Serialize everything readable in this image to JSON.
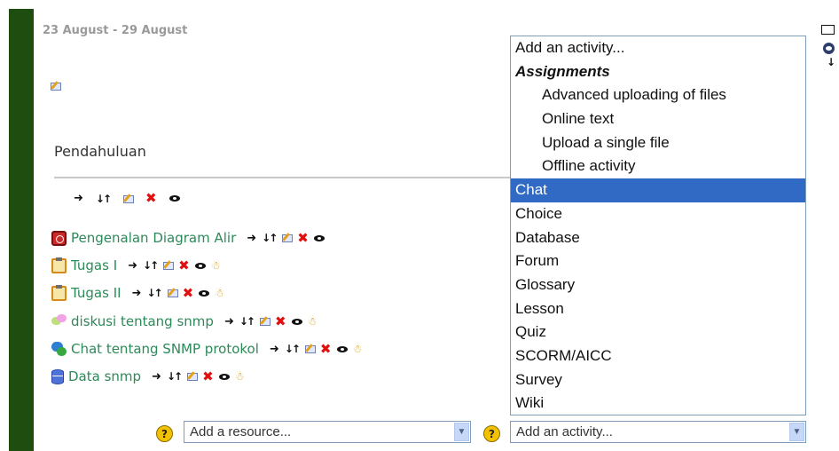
{
  "section": {
    "date_range": "23 August - 29 August",
    "title": "Pendahuluan"
  },
  "activities": [
    {
      "name": "Pengenalan Diagram Alir",
      "icon": "lesson-icon",
      "has_roles": false
    },
    {
      "name": "Tugas I",
      "icon": "assignment-icon",
      "has_roles": true
    },
    {
      "name": "Tugas II",
      "icon": "assignment-icon",
      "has_roles": true
    },
    {
      "name": "diskusi tentang snmp",
      "icon": "forum-icon",
      "has_roles": true
    },
    {
      "name": "Chat tentang SNMP protokol",
      "icon": "chat-icon",
      "has_roles": true
    },
    {
      "name": "Data snmp",
      "icon": "database-icon",
      "has_roles": true
    }
  ],
  "add_resource": {
    "selected": "Add a resource..."
  },
  "add_activity": {
    "selected": "Add an activity...",
    "options": [
      {
        "label": "Add an activity...",
        "type": "option"
      },
      {
        "label": "Assignments",
        "type": "group"
      },
      {
        "label": "Advanced uploading of files",
        "type": "indent"
      },
      {
        "label": "Online text",
        "type": "indent"
      },
      {
        "label": "Upload a single file",
        "type": "indent"
      },
      {
        "label": "Offline activity",
        "type": "indent"
      },
      {
        "label": "Chat",
        "type": "option",
        "highlighted": true
      },
      {
        "label": "Choice",
        "type": "option"
      },
      {
        "label": "Database",
        "type": "option"
      },
      {
        "label": "Forum",
        "type": "option"
      },
      {
        "label": "Glossary",
        "type": "option"
      },
      {
        "label": "Lesson",
        "type": "option"
      },
      {
        "label": "Quiz",
        "type": "option"
      },
      {
        "label": "SCORM/AICC",
        "type": "option"
      },
      {
        "label": "Survey",
        "type": "option"
      },
      {
        "label": "Wiki",
        "type": "option"
      }
    ]
  },
  "help_icon_label": "?",
  "colors": {
    "left_bar": "#1f4d10",
    "link": "#2c8a58",
    "highlight": "#316ac5"
  }
}
